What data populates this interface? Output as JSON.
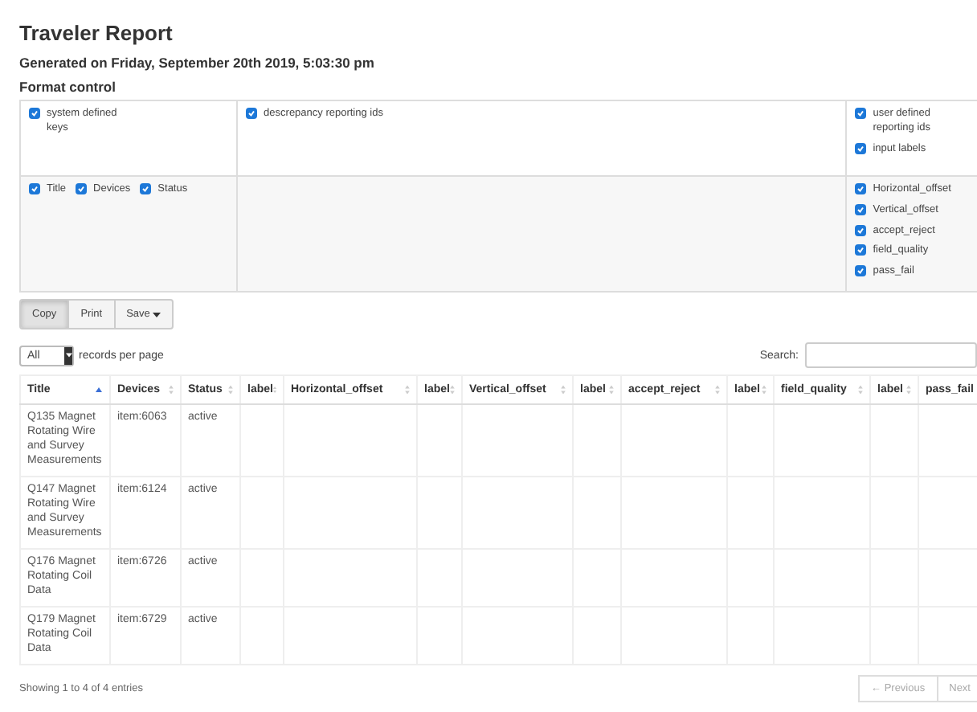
{
  "heading": "Traveler Report",
  "generated": "Generated on Friday, September 20th 2019, 5:03:30 pm",
  "format_control": {
    "title": "Format control",
    "rows": [
      {
        "cells": [
          {
            "inline": false,
            "items": [
              {
                "label": "system defined keys",
                "checked": true
              }
            ]
          },
          {
            "inline": false,
            "items": [
              {
                "label": "descrepancy reporting ids",
                "checked": true
              }
            ]
          },
          {
            "inline": false,
            "items": [
              {
                "label": "user defined reporting ids",
                "checked": true
              },
              {
                "label": "input labels",
                "checked": true
              }
            ]
          }
        ]
      },
      {
        "cells": [
          {
            "inline": true,
            "items": [
              {
                "label": "Title",
                "checked": true
              },
              {
                "label": "Devices",
                "checked": true
              },
              {
                "label": "Status",
                "checked": true
              }
            ]
          },
          {},
          {
            "inline": false,
            "items": [
              {
                "label": "Horizontal_offset",
                "checked": true
              },
              {
                "label": "Vertical_offset",
                "checked": true
              },
              {
                "label": "accept_reject",
                "checked": true
              },
              {
                "label": "field_quality",
                "checked": true
              },
              {
                "label": "pass_fail",
                "checked": true
              }
            ]
          }
        ]
      }
    ]
  },
  "buttons": [
    {
      "label": "Copy",
      "pressed": true,
      "menu": false
    },
    {
      "label": "Print",
      "pressed": false,
      "menu": false
    },
    {
      "label": "Save",
      "pressed": false,
      "menu": true
    }
  ],
  "length": {
    "value": "All",
    "label": "records per page"
  },
  "search": {
    "label": "Search:"
  },
  "table": {
    "columns": [
      {
        "label": "Title",
        "sorted": true
      },
      {
        "label": "Devices",
        "sorted": false
      },
      {
        "label": "Status",
        "sorted": false
      },
      {
        "label": "label",
        "sorted": false
      },
      {
        "label": "Horizontal_offset",
        "sorted": false
      },
      {
        "label": "label",
        "sorted": false
      },
      {
        "label": "Vertical_offset",
        "sorted": false
      },
      {
        "label": "label",
        "sorted": false
      },
      {
        "label": "accept_reject",
        "sorted": false
      },
      {
        "label": "label",
        "sorted": false
      },
      {
        "label": "field_quality",
        "sorted": false
      },
      {
        "label": "label",
        "sorted": false
      },
      {
        "label": "pass_fail"
      }
    ],
    "rows": [
      {
        "title": "Q135 Magnet Rotating Wire and Survey Measurements",
        "devices": "item:6063",
        "status": "active"
      },
      {
        "title": "Q147 Magnet Rotating Wire and Survey Measurements",
        "devices": "item:6124",
        "status": "active"
      },
      {
        "title": "Q176 Magnet Rotating Coil Data",
        "devices": "item:6726",
        "status": "active"
      },
      {
        "title": "Q179 Magnet Rotating Coil Data",
        "devices": "item:6729",
        "status": "active"
      }
    ]
  },
  "info": "Showing 1 to 4 of 4 entries",
  "pagination": [
    {
      "label": "← Previous",
      "disabled": true
    },
    {
      "label": "Next",
      "disabled": true
    }
  ]
}
